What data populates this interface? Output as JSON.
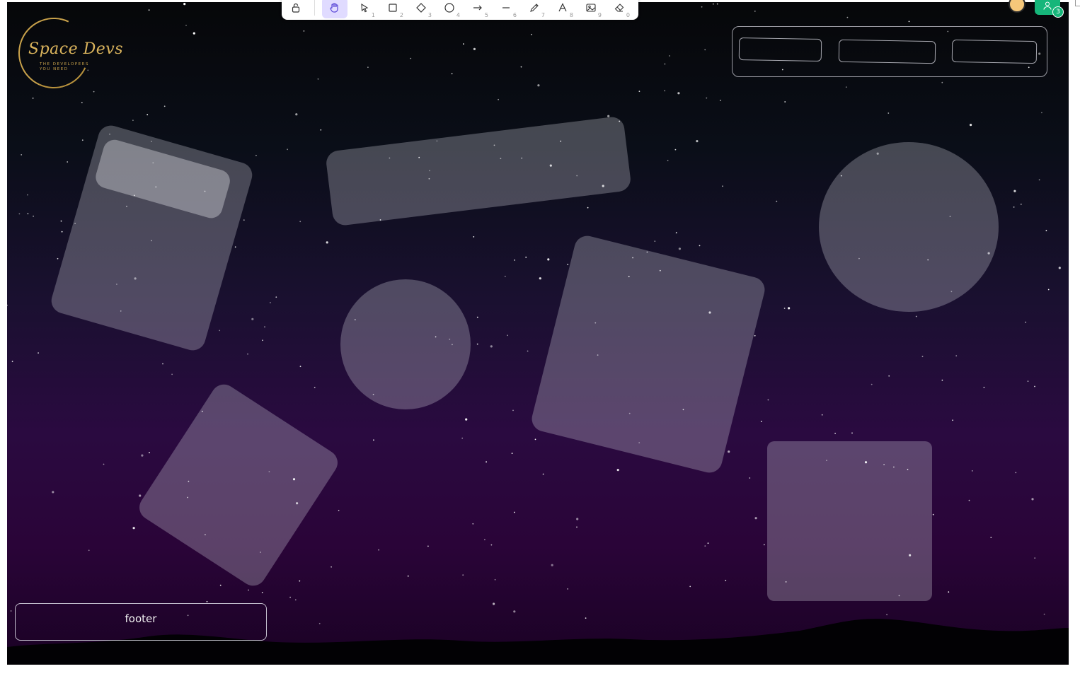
{
  "toolbar": {
    "lock": {
      "icon": "lock-icon"
    },
    "tools": [
      {
        "icon": "hand-icon",
        "key": "",
        "active": true
      },
      {
        "icon": "pointer-icon",
        "key": "1"
      },
      {
        "icon": "rectangle-icon",
        "key": "2"
      },
      {
        "icon": "diamond-icon",
        "key": "3"
      },
      {
        "icon": "ellipse-icon",
        "key": "4"
      },
      {
        "icon": "arrow-icon",
        "key": "5"
      },
      {
        "icon": "line-icon",
        "key": "6"
      },
      {
        "icon": "pencil-icon",
        "key": "7"
      },
      {
        "icon": "text-icon",
        "key": "8"
      },
      {
        "icon": "image-icon",
        "key": "9"
      },
      {
        "icon": "eraser-icon",
        "key": "0"
      }
    ]
  },
  "collaborators": {
    "count": "3"
  },
  "logo": {
    "title": "Space Devs",
    "subtitle": "THE DEVELOPERS YOU NEED"
  },
  "footer": {
    "label": "footer"
  },
  "colors": {
    "accent": "#e0dbff",
    "collab": "#16b67a",
    "logo_gold": "#d9b35c"
  }
}
